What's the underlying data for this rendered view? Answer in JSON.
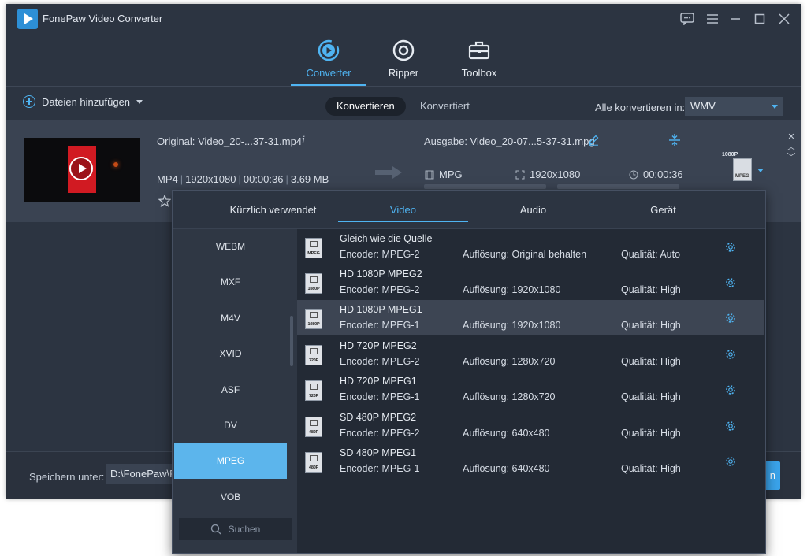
{
  "app": {
    "title": "FonePaw Video Converter"
  },
  "nav": [
    {
      "label": "Converter",
      "icon": "converter-icon",
      "active": true
    },
    {
      "label": "Ripper",
      "icon": "ripper-icon",
      "active": false
    },
    {
      "label": "Toolbox",
      "icon": "toolbox-icon",
      "active": false
    }
  ],
  "toolbar": {
    "add_files": "Dateien hinzufügen",
    "tabs": [
      "Konvertieren",
      "Konvertiert"
    ],
    "convert_all_label": "Alle konvertieren in:",
    "convert_all_value": "WMV"
  },
  "file": {
    "original": "Original: Video_20-...37-31.mp4",
    "format": "MP4",
    "resolution": "1920x1080",
    "duration": "00:00:36",
    "size": "3.69 MB",
    "output": "Ausgabe: Video_20-07...5-37-31.mpg",
    "out_format": "MPG",
    "out_resolution": "1920x1080",
    "out_duration": "00:00:36",
    "badge_top": "1080P",
    "badge_label": "MPEG"
  },
  "bottom": {
    "save_label": "Speichern unter:",
    "save_path": "D:\\FonePaw\\F",
    "start_label": "n"
  },
  "dropdown": {
    "tabs": [
      "Kürzlich verwendet",
      "Video",
      "Audio",
      "Gerät"
    ],
    "active_tab": 1,
    "categories": [
      "WEBM",
      "MXF",
      "M4V",
      "XVID",
      "ASF",
      "DV",
      "MPEG",
      "VOB"
    ],
    "active_category": 6,
    "search_placeholder": "Suchen",
    "presets": [
      {
        "name": "Gleich wie die Quelle",
        "icon_label": "MPEG",
        "encoder": "Encoder: MPEG-2",
        "resolution": "Auflösung: Original behalten",
        "quality": "Qualität: Auto"
      },
      {
        "name": "HD 1080P MPEG2",
        "icon_label": "1080P",
        "encoder": "Encoder: MPEG-2",
        "resolution": "Auflösung: 1920x1080",
        "quality": "Qualität: High"
      },
      {
        "name": "HD 1080P MPEG1",
        "icon_label": "1080P",
        "encoder": "Encoder: MPEG-1",
        "resolution": "Auflösung: 1920x1080",
        "quality": "Qualität: High"
      },
      {
        "name": "HD 720P MPEG2",
        "icon_label": "720P",
        "encoder": "Encoder: MPEG-2",
        "resolution": "Auflösung: 1280x720",
        "quality": "Qualität: High"
      },
      {
        "name": "HD 720P MPEG1",
        "icon_label": "720P",
        "encoder": "Encoder: MPEG-1",
        "resolution": "Auflösung: 1280x720",
        "quality": "Qualität: High"
      },
      {
        "name": "SD 480P MPEG2",
        "icon_label": "480P",
        "encoder": "Encoder: MPEG-2",
        "resolution": "Auflösung: 640x480",
        "quality": "Qualität: High"
      },
      {
        "name": "SD 480P MPEG1",
        "icon_label": "480P",
        "encoder": "Encoder: MPEG-1",
        "resolution": "Auflösung: 640x480",
        "quality": "Qualität: High"
      }
    ],
    "selected_preset": 2
  },
  "colors": {
    "accent": "#4fb4f2",
    "background": "#2c3441",
    "selected_category": "#5cb5ec"
  }
}
